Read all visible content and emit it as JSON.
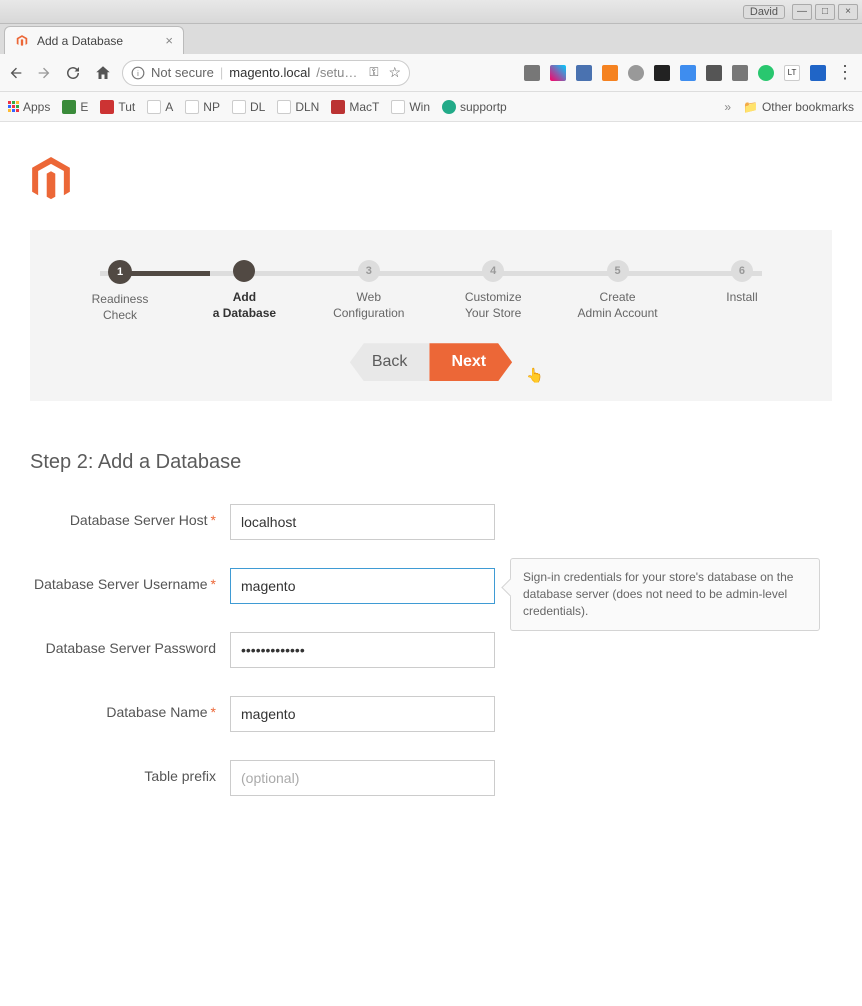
{
  "window": {
    "user": "David"
  },
  "tab": {
    "title": "Add a Database"
  },
  "address": {
    "security_label": "Not secure",
    "host": "magento.local",
    "path": "/setu…"
  },
  "bookmarks": {
    "apps": "Apps",
    "items": [
      "E",
      "Tut",
      "A",
      "NP",
      "DL",
      "DLN",
      "MacT",
      "Win",
      "supportp"
    ],
    "other": "Other bookmarks"
  },
  "steps": [
    {
      "num": "1",
      "label_line1": "Readiness",
      "label_line2": "Check"
    },
    {
      "num": "",
      "label_line1": "Add",
      "label_line2": "a Database"
    },
    {
      "num": "3",
      "label_line1": "Web",
      "label_line2": "Configuration"
    },
    {
      "num": "4",
      "label_line1": "Customize",
      "label_line2": "Your Store"
    },
    {
      "num": "5",
      "label_line1": "Create",
      "label_line2": "Admin Account"
    },
    {
      "num": "6",
      "label_line1": "Install",
      "label_line2": ""
    }
  ],
  "buttons": {
    "back": "Back",
    "next": "Next"
  },
  "section_title": "Step 2: Add a Database",
  "form": {
    "host": {
      "label": "Database Server Host",
      "value": "localhost"
    },
    "username": {
      "label": "Database Server Username",
      "value": "magento",
      "hint": "Sign-in credentials for your store's database on the database server (does not need to be admin-level credentials)."
    },
    "password": {
      "label": "Database Server Password",
      "value": "•••••••••••••"
    },
    "dbname": {
      "label": "Database Name",
      "value": "magento"
    },
    "prefix": {
      "label": "Table prefix",
      "placeholder": "(optional)"
    }
  }
}
